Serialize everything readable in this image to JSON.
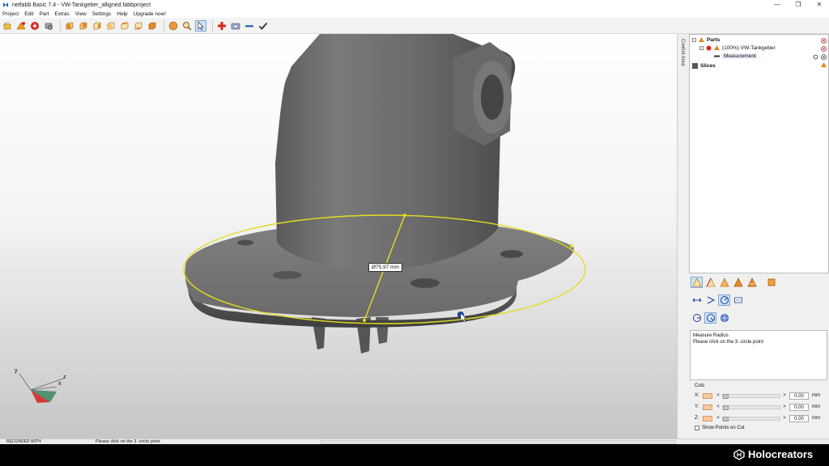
{
  "window": {
    "title": "netfabb Basic 7.4 - VW-Tankgeber_alligned.fabbproject",
    "controls": [
      "—",
      "❐",
      "✕"
    ]
  },
  "menu": [
    "Project",
    "Edit",
    "Part",
    "Extras",
    "View",
    "Settings",
    "Help",
    "Upgrade now!"
  ],
  "toolbar": {
    "icons": [
      "new-project-icon",
      "open-part-icon",
      "repair-icon",
      "print-icon",
      "view-front-icon",
      "view-back-icon",
      "view-left-icon",
      "view-right-icon",
      "view-top-icon",
      "view-bottom-icon",
      "view-iso-icon",
      "sphere-icon",
      "zoom-icon",
      "select-pointer-icon",
      "add-part-icon",
      "measure-icon",
      "ruler-icon",
      "apply-check-icon"
    ]
  },
  "viewport": {
    "measurement_label": "Ø75,97 mm",
    "axis_labels": {
      "y": "y",
      "x": "x",
      "z": "z"
    },
    "accent_color": "#e6dc1e"
  },
  "side_strip": {
    "label": "Control Area"
  },
  "tree": {
    "parts_label": "Parts",
    "part_label": "(100%) VW-Tankgeber",
    "measurement_label": "Measurement",
    "slices_label": "Slices"
  },
  "info": {
    "title": "Measure Radius",
    "text": "Please click on the 3. circle point"
  },
  "cuts": {
    "title": "Cuts",
    "rows": [
      {
        "axis": "X:",
        "value": "0.00",
        "unit": "mm"
      },
      {
        "axis": "Y:",
        "value": "0.00",
        "unit": "mm"
      },
      {
        "axis": "Z:",
        "value": "0.00",
        "unit": "mm"
      }
    ],
    "show_points_label": "Show Points on Cut"
  },
  "status": {
    "watermark": "RECORDED WITH",
    "message": "Please click on the 3. circle point"
  },
  "brand": {
    "name": "Holocreators"
  }
}
